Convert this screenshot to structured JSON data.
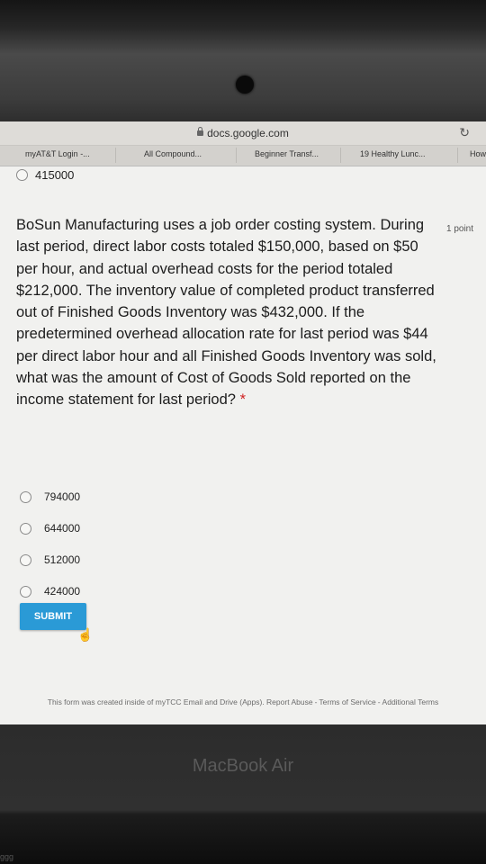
{
  "browser": {
    "url": "docs.google.com",
    "bookmarks": [
      "myAT&T Login -...",
      "All Compound...",
      "Beginner Transf...",
      "19 Healthy Lunc...",
      "How"
    ]
  },
  "form": {
    "previous_option": "415000",
    "question": "BoSun Manufacturing uses a job order costing system. During last period, direct labor costs totaled $150,000, based on $50 per hour, and actual overhead costs for the period totaled $212,000. The inventory value of completed product transferred out of Finished Goods Inventory was $432,000. If the predetermined overhead allocation rate for last period was $44 per direct labor hour and all Finished Goods Inventory was sold, what was the amount of Cost of Goods Sold reported on the income statement for last period?",
    "required_mark": "*",
    "points": "1 point",
    "options": [
      "794000",
      "644000",
      "512000",
      "424000"
    ],
    "submit_label": "SUBMIT",
    "footer": {
      "text": "This form was created inside of myTCC Email and Drive (Apps).",
      "links": [
        "Report Abuse",
        "Terms of Service",
        "Additional Terms"
      ]
    }
  },
  "device": {
    "brand": "MacBook Air",
    "corner_label": "ggg"
  }
}
